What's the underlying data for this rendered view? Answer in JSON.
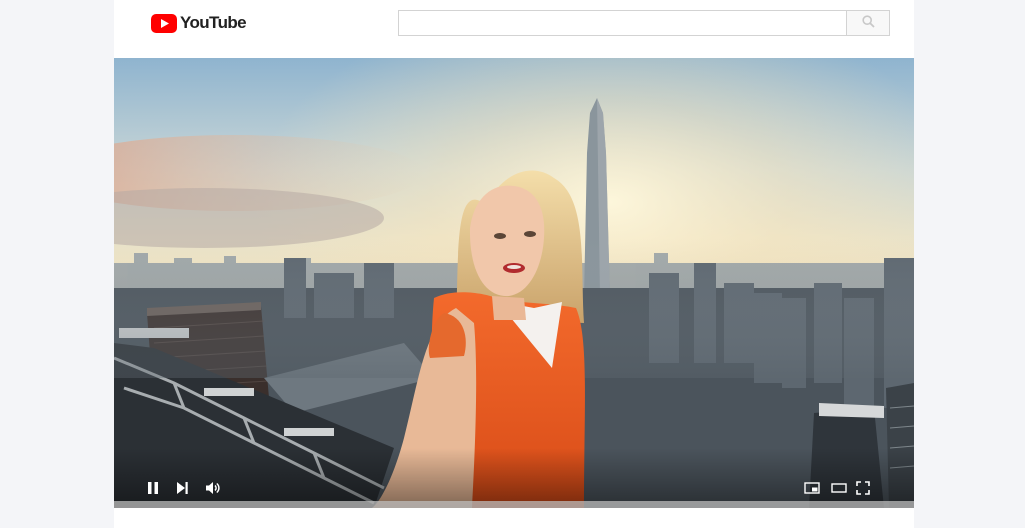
{
  "header": {
    "logo_text": "YouTube",
    "brand_color": "#ff0000"
  },
  "search": {
    "placeholder": "",
    "value": "",
    "icon": "search-icon"
  },
  "player": {
    "state": "playing",
    "progress": 0,
    "controls": {
      "play_pause_icon": "pause-icon",
      "next_icon": "next-icon",
      "volume_icon": "volume-icon",
      "miniplayer_icon": "miniplayer-icon",
      "theater_icon": "theater-mode-icon",
      "fullscreen_icon": "fullscreen-icon"
    }
  }
}
